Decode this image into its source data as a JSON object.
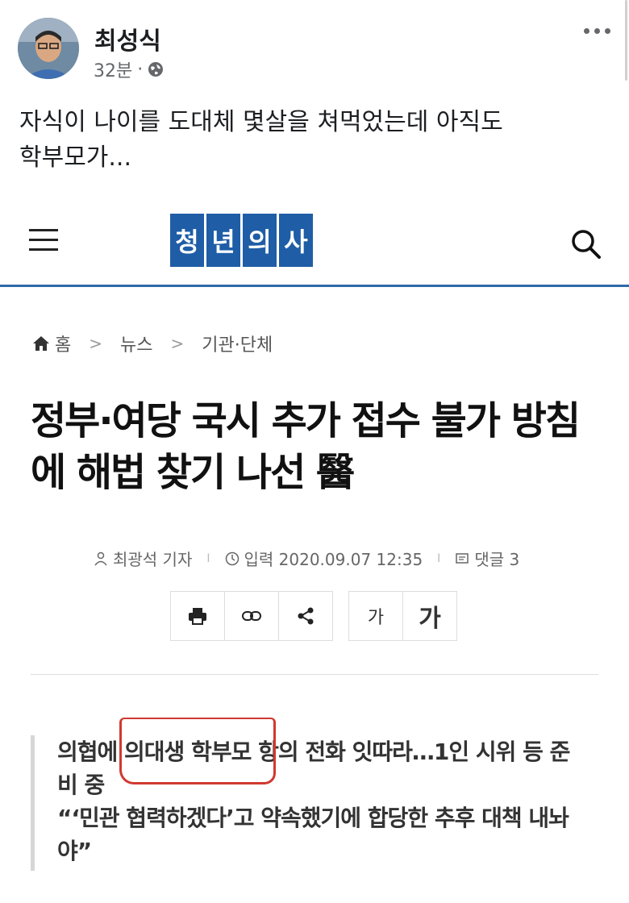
{
  "post": {
    "author": "최성식",
    "time": "32분",
    "dot": "·",
    "more_icon": "more-dots-icon",
    "text_lines": [
      "자식이 나이를 도대체 몇살을 쳐먹었는데 아직도",
      "학부모가..."
    ]
  },
  "article": {
    "logo_chars": [
      "청",
      "년",
      "의",
      "사"
    ],
    "breadcrumb": {
      "home": "홈",
      "items": [
        "뉴스",
        "기관·단체"
      ],
      "sep": ">"
    },
    "headline_lines": [
      "정부·여당 국시 추가 접수 불가 방침",
      "에 해법 찾기 나선 醫"
    ],
    "byline": {
      "reporter": "최광석 기자",
      "date": "입력 2020.09.07 12:35",
      "comments": "댓글 3",
      "sep": "I"
    },
    "tools": {
      "font_small": "가",
      "font_large": "가"
    },
    "quote_lines": [
      "의협에 의대생 학부모 항의 전화 잇따라…1인 시위 등 준",
      "비 중",
      "“‘민관 협력하겠다’고 약속했기에 합당한 추후 대책 내놔",
      "야”"
    ]
  },
  "colors": {
    "logo_blue": "#1f5da6",
    "rule_blue": "#2f6aa8",
    "annotation_red": "#d0392f"
  }
}
